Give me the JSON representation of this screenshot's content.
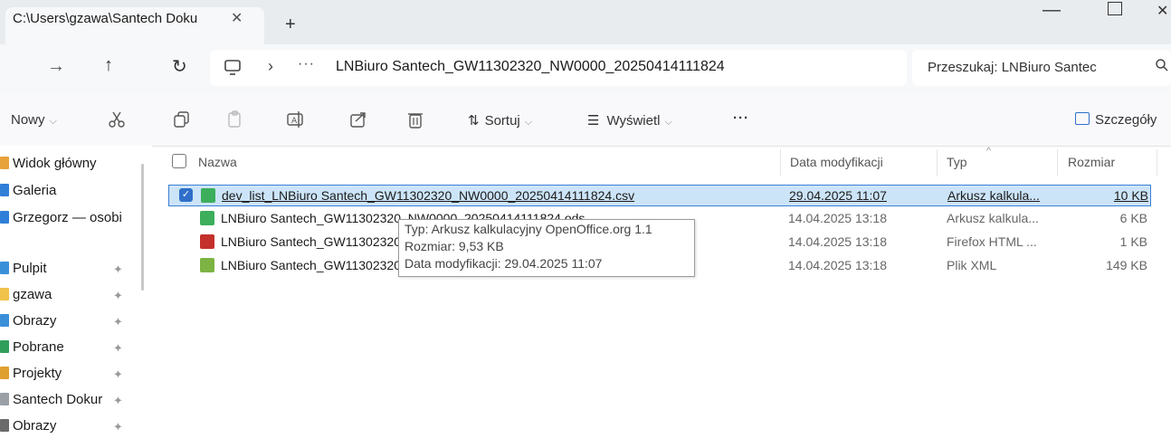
{
  "window": {
    "tab_title": "C:\\Users\\gzawa\\Santech Doku",
    "tab_close": "✕",
    "new_tab": "+",
    "minimize": "—",
    "close": "✕"
  },
  "nav": {
    "back": "←",
    "forward": "→",
    "up": "↑",
    "refresh": "↻",
    "separator": "›",
    "more": "···",
    "path": "LNBiuro Santech_GW11302320_NW0000_20250414111824",
    "search_placeholder": "Przeszukaj: LNBiuro Santec"
  },
  "toolbar": {
    "new_label": "Nowy",
    "sort_label": "Sortuj",
    "view_label": "Wyświetl",
    "more_label": "···",
    "details_label": "Szczegóły",
    "icons": [
      "cut-icon",
      "copy-icon",
      "paste-icon",
      "rename-icon",
      "share-icon",
      "delete-icon"
    ]
  },
  "sidebar": {
    "items": [
      {
        "label": "Widok główny",
        "color": "#e8a23a",
        "pinned": false
      },
      {
        "label": "Galeria",
        "color": "#2f7fd8",
        "pinned": false
      },
      {
        "label": "Grzegorz — osobi",
        "color": "#2f7fd8",
        "pinned": false
      },
      {
        "label": "Pulpit",
        "color": "#3a8fd9",
        "pinned": true
      },
      {
        "label": "gzawa",
        "color": "#f0c24a",
        "pinned": true
      },
      {
        "label": "Obrazy",
        "color": "#3a8fd9",
        "pinned": true
      },
      {
        "label": "Pobrane",
        "color": "#2f9e5a",
        "pinned": true
      },
      {
        "label": "Projekty",
        "color": "#e0a030",
        "pinned": true
      },
      {
        "label": "Santech Dokur",
        "color": "#9aa0a6",
        "pinned": true
      },
      {
        "label": "Obrazy",
        "color": "#6b6b6b",
        "pinned": true
      }
    ],
    "pin_glyph": "✦"
  },
  "columns": {
    "name": "Nazwa",
    "modified": "Data modyfikacji",
    "type": "Typ",
    "size": "Rozmiar",
    "sort_indicator": "^"
  },
  "files": [
    {
      "name": "dev_list_LNBiuro Santech_GW11302320_NW0000_20250414111824.csv",
      "modified": "29.04.2025 11:07",
      "type": "Arkusz kalkula...",
      "size": "10 KB",
      "icon_color": "#3cae5c",
      "selected": true
    },
    {
      "name": "LNBiuro Santech_GW11302320_NW0000_20250414111824.ods",
      "modified": "14.04.2025 13:18",
      "type": "Arkusz kalkula...",
      "size": "6 KB",
      "icon_color": "#3cae5c",
      "selected": false
    },
    {
      "name": "LNBiuro Santech_GW11302320_NW0000_20250414111824.html",
      "modified": "14.04.2025 13:18",
      "type": "Firefox HTML ...",
      "size": "1 KB",
      "icon_color": "#c4302b",
      "selected": false
    },
    {
      "name": "LNBiuro Santech_GW11302320_NW0000_20250414111824.xml",
      "modified": "14.04.2025 13:18",
      "type": "Plik XML",
      "size": "149 KB",
      "icon_color": "#7cb342",
      "selected": false
    }
  ],
  "tooltip": {
    "type": "Typ: Arkusz kalkulacyjny OpenOffice.org 1.1",
    "size": "Rozmiar: 9,53 KB",
    "modified": "Data modyfikacji: 29.04.2025 11:07"
  }
}
